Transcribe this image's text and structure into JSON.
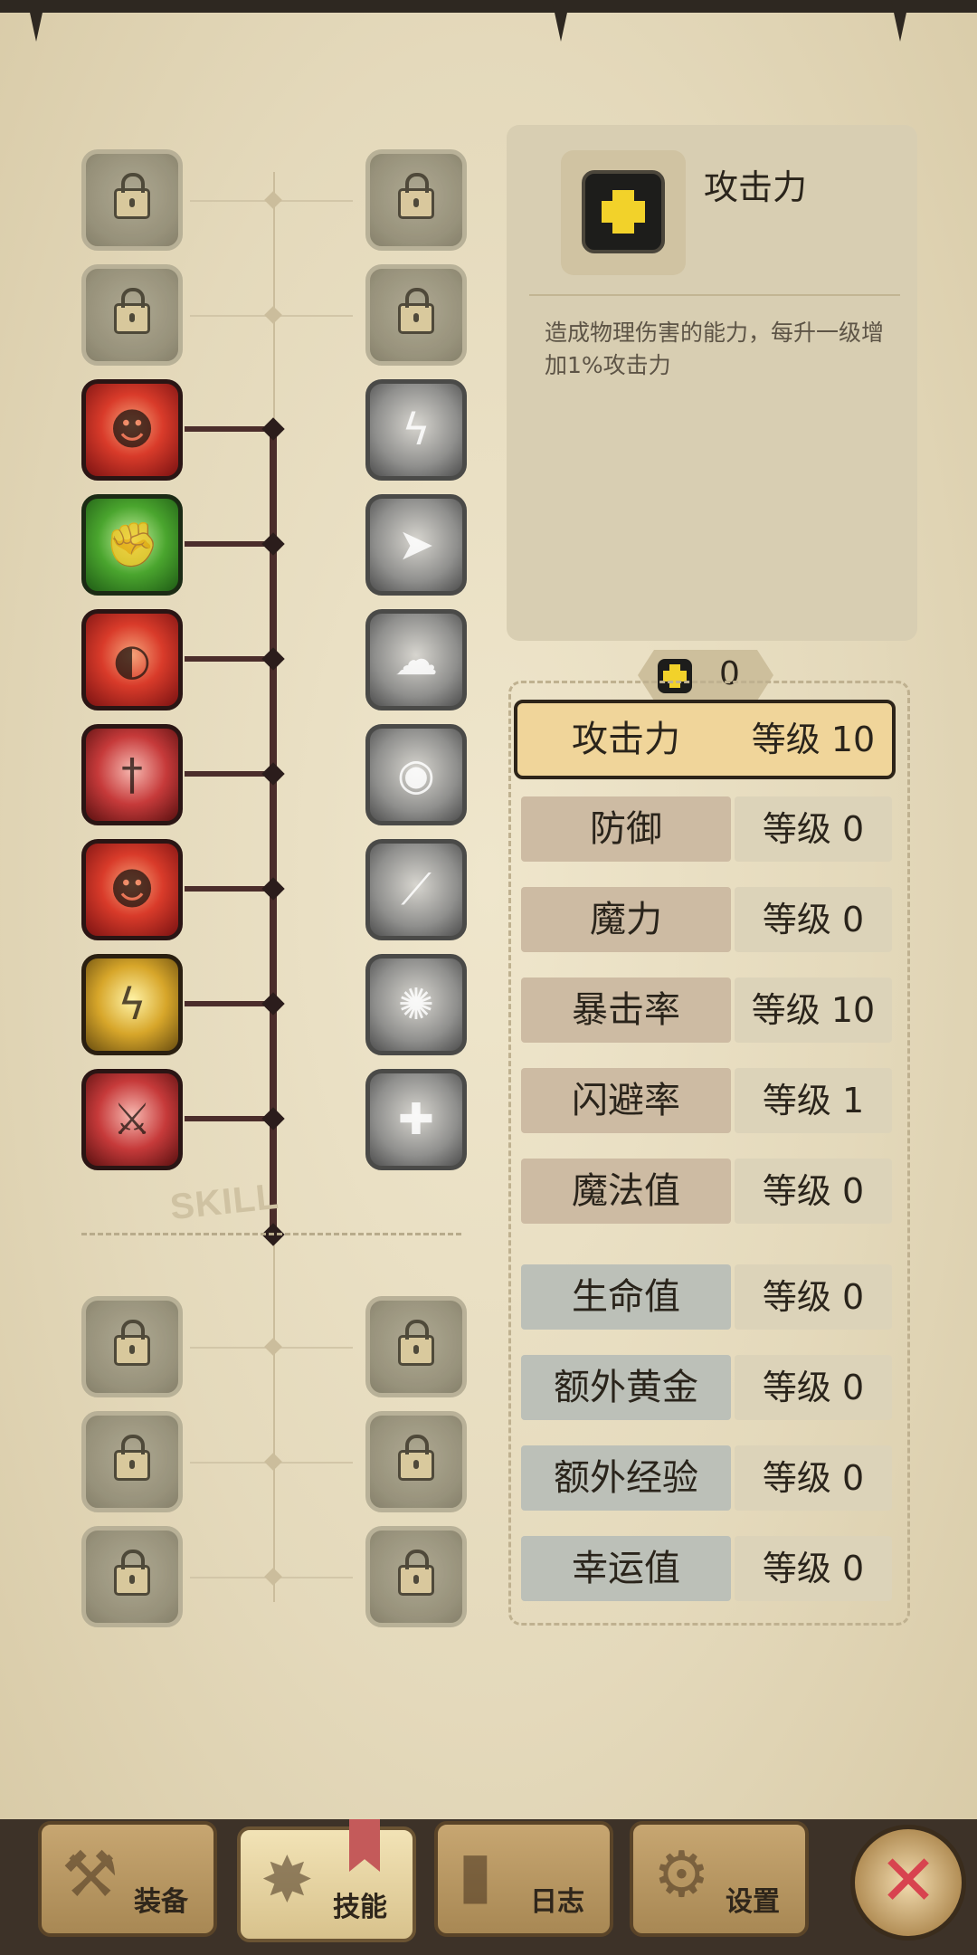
{
  "skill_panel": {
    "title": "攻击力",
    "description": "造成物理伤害的能力，每升一级增加1%攻击力",
    "icon": "plus-icon"
  },
  "skill_points": {
    "icon": "plus-icon",
    "value": "0"
  },
  "tree_label": "SKILL",
  "stats": [
    {
      "name": "攻击力",
      "level": "等级 10"
    },
    {
      "name": "防御",
      "level": "等级 0"
    },
    {
      "name": "魔力",
      "level": "等级 0"
    },
    {
      "name": "暴击率",
      "level": "等级 10"
    },
    {
      "name": "闪避率",
      "level": "等级 1"
    },
    {
      "name": "魔法值",
      "level": "等级 0"
    },
    {
      "name": "生命值",
      "level": "等级 0"
    },
    {
      "name": "额外黄金",
      "level": "等级 0"
    },
    {
      "name": "额外经验",
      "level": "等级 0"
    },
    {
      "name": "幸运值",
      "level": "等级 0"
    }
  ],
  "tabs": [
    {
      "label": "装备",
      "icon": "armor-icon"
    },
    {
      "label": "技能",
      "icon": "skill-icon"
    },
    {
      "label": "日志",
      "icon": "book-icon"
    },
    {
      "label": "设置",
      "icon": "gear-icon"
    }
  ],
  "close_button": {
    "icon": "close-icon"
  },
  "colors": {
    "background": "#e6dcc0",
    "accent_yellow": "#f2d22a",
    "tree_active": "#4b2d2b",
    "close_red": "#d8434f"
  }
}
